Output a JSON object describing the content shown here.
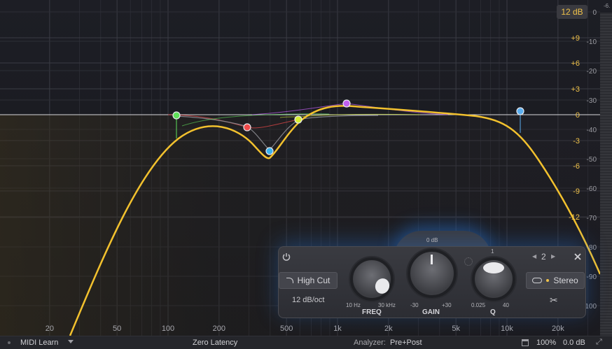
{
  "display": {
    "range_chip": "12 dB",
    "gain_scale": [
      "+9",
      "+6",
      "+3",
      "0",
      "-3",
      "-6",
      "-9",
      "-12"
    ],
    "analyzer_scale": [
      "0",
      "-10",
      "-20",
      "-30",
      "-40",
      "-50",
      "-60",
      "-70",
      "-80",
      "-90",
      "-100"
    ],
    "corner_label": "-6.",
    "freq_labels": [
      "20",
      "50",
      "100",
      "200",
      "500",
      "1k",
      "2k",
      "5k",
      "10k",
      "20k"
    ],
    "colors": {
      "curve": "#f2c12e",
      "band_green": "#5fe05a",
      "band_red": "#f04a4a",
      "band_blue": "#3ab3f0",
      "band_yellow": "#d7ef34",
      "band_purple": "#c15ff0",
      "band_cut": "#5aaef0",
      "gain_scale_text": "#f1c34a",
      "analyzer_scale_text": "#9a9aa0"
    }
  },
  "panel": {
    "power_icon": "power-icon",
    "filter_type": "High Cut",
    "slope": "12 dB/oct",
    "freq": {
      "label": "FREQ",
      "min": "10 Hz",
      "max": "30 kHz"
    },
    "gain": {
      "label": "GAIN",
      "top": "0 dB",
      "min": "-30",
      "max": "+30"
    },
    "q": {
      "label": "Q",
      "top": "1",
      "min": "0.025",
      "max": "40"
    },
    "band_nav": {
      "prev": "◀",
      "index": "2",
      "next": "▶"
    },
    "close_icon": "close-icon",
    "stereo_label": "Stereo",
    "scissors_icon": "scissors-icon"
  },
  "status": {
    "midi_learn": "MIDI Learn",
    "latency": "Zero Latency",
    "analyzer_label": "Analyzer:",
    "analyzer_value": "Pre+Post",
    "zoom": "100%",
    "output_gain": "0.0 dB"
  }
}
